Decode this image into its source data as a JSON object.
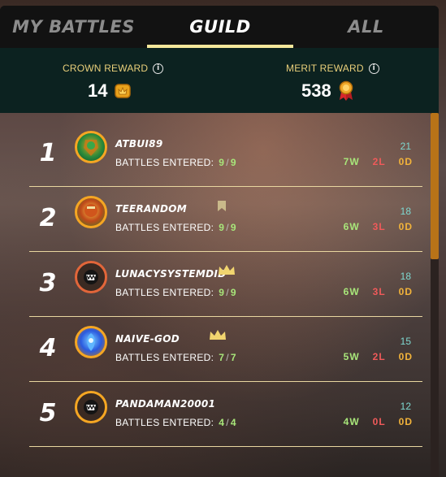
{
  "tabs": [
    {
      "label": "MY BATTLES",
      "active": false
    },
    {
      "label": "GUILD",
      "active": true
    },
    {
      "label": "ALL",
      "active": false
    }
  ],
  "rewards": {
    "crown": {
      "label": "CROWN REWARD",
      "value": "14",
      "icon": "crown-token-icon"
    },
    "merit": {
      "label": "MERIT REWARD",
      "value": "538",
      "icon": "merit-medal-icon"
    }
  },
  "battles_label": "BATTLES ENTERED:",
  "rows": [
    {
      "rank": "1",
      "name": "ATBUI89",
      "entered": "9",
      "total": "9",
      "score": "21",
      "w": "7W",
      "l": "2L",
      "d": "0D",
      "badge": ""
    },
    {
      "rank": "2",
      "name": "TEERANDOM",
      "entered": "9",
      "total": "9",
      "score": "18",
      "w": "6W",
      "l": "3L",
      "d": "0D",
      "badge": "bookmark-icon"
    },
    {
      "rank": "3",
      "name": "LUNACYSYSTEMDID",
      "entered": "9",
      "total": "9",
      "score": "18",
      "w": "6W",
      "l": "3L",
      "d": "0D",
      "badge": "crown-icon"
    },
    {
      "rank": "4",
      "name": "NAIVE-GOD",
      "entered": "7",
      "total": "7",
      "score": "15",
      "w": "5W",
      "l": "2L",
      "d": "0D",
      "badge": "crown-icon"
    },
    {
      "rank": "5",
      "name": "PANDAMAN20001",
      "entered": "4",
      "total": "4",
      "score": "12",
      "w": "4W",
      "l": "0L",
      "d": "0D",
      "badge": ""
    }
  ],
  "colors": {
    "accent": "#f4e79b",
    "win": "#a8e67a",
    "loss": "#f05a5a",
    "draw": "#f2b33a",
    "score": "#7ed8d0"
  }
}
